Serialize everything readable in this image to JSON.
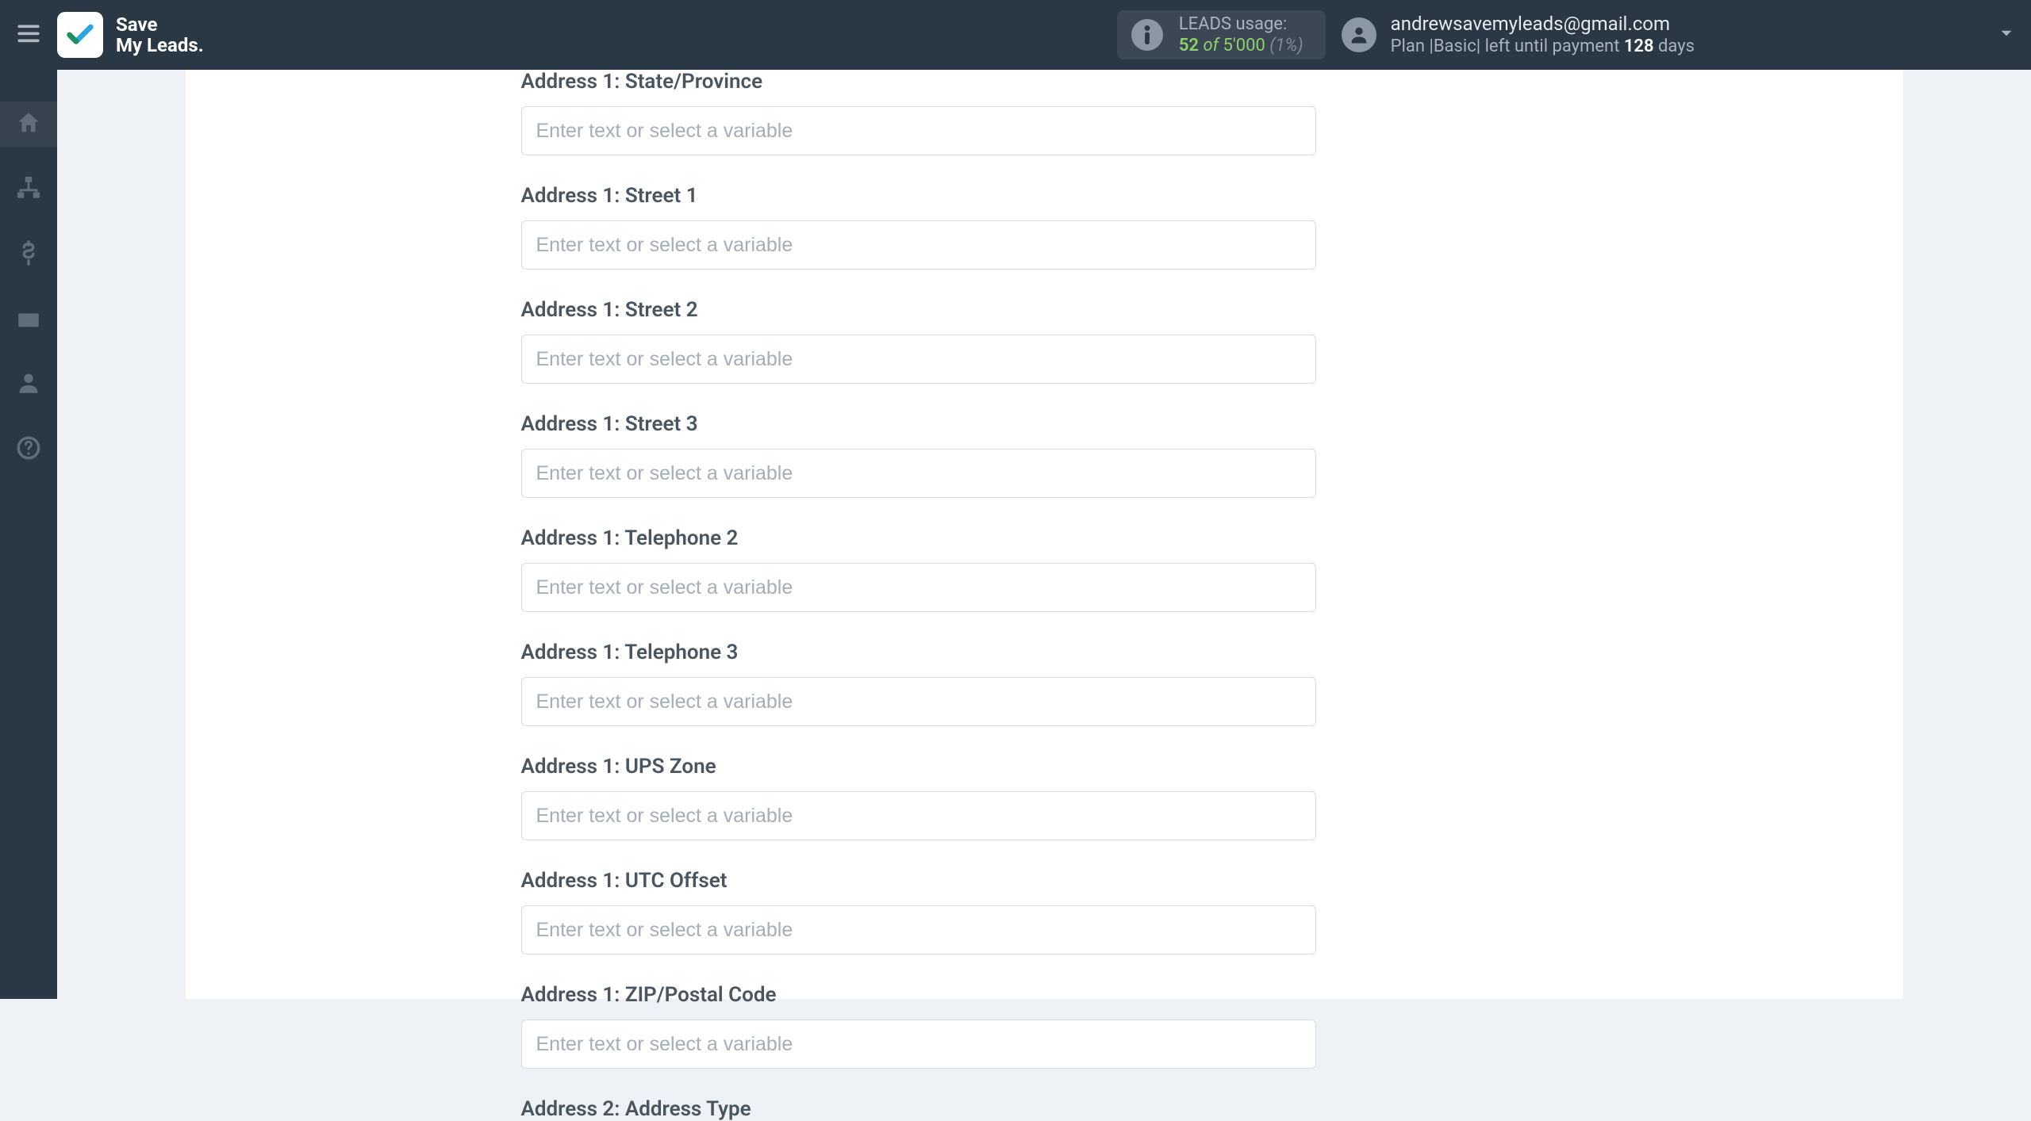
{
  "brand": {
    "line1": "Save",
    "line2": "My Leads."
  },
  "usage": {
    "label": "LEADS usage:",
    "used": "52",
    "of_word": "of",
    "cap": "5'000",
    "pct": "(1%)"
  },
  "account": {
    "email": "andrewsavemyleads@gmail.com",
    "plan_prefix": "Plan |",
    "plan_name": "Basic",
    "plan_mid": "| left until payment ",
    "days_num": "128",
    "days_word": " days"
  },
  "form": {
    "placeholder": "Enter text or select a variable",
    "fields": [
      {
        "label": "Address 1: State/Province"
      },
      {
        "label": "Address 1: Street 1"
      },
      {
        "label": "Address 1: Street 2"
      },
      {
        "label": "Address 1: Street 3"
      },
      {
        "label": "Address 1: Telephone 2"
      },
      {
        "label": "Address 1: Telephone 3"
      },
      {
        "label": "Address 1: UPS Zone"
      },
      {
        "label": "Address 1: UTC Offset"
      },
      {
        "label": "Address 1: ZIP/Postal Code"
      },
      {
        "label": "Address 2: Address Type"
      }
    ]
  }
}
